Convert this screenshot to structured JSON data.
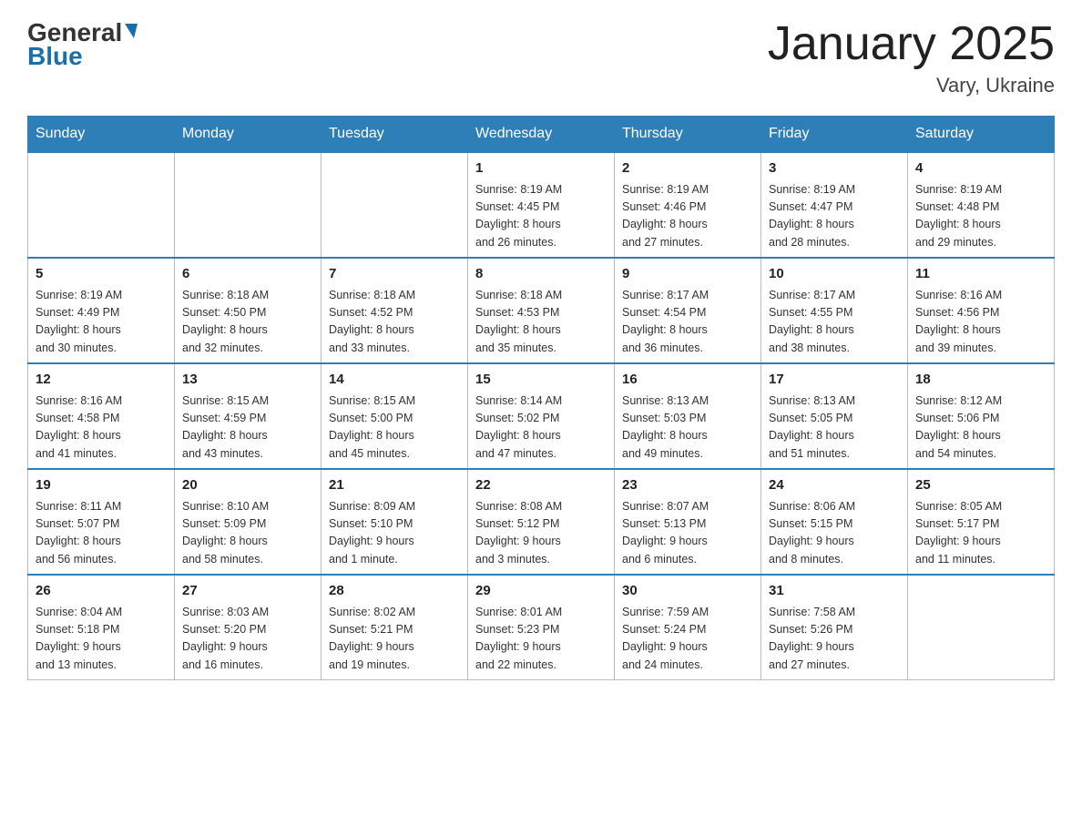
{
  "logo": {
    "general": "General",
    "blue": "Blue"
  },
  "title": "January 2025",
  "subtitle": "Vary, Ukraine",
  "days_of_week": [
    "Sunday",
    "Monday",
    "Tuesday",
    "Wednesday",
    "Thursday",
    "Friday",
    "Saturday"
  ],
  "weeks": [
    [
      {
        "day": "",
        "info": ""
      },
      {
        "day": "",
        "info": ""
      },
      {
        "day": "",
        "info": ""
      },
      {
        "day": "1",
        "info": "Sunrise: 8:19 AM\nSunset: 4:45 PM\nDaylight: 8 hours\nand 26 minutes."
      },
      {
        "day": "2",
        "info": "Sunrise: 8:19 AM\nSunset: 4:46 PM\nDaylight: 8 hours\nand 27 minutes."
      },
      {
        "day": "3",
        "info": "Sunrise: 8:19 AM\nSunset: 4:47 PM\nDaylight: 8 hours\nand 28 minutes."
      },
      {
        "day": "4",
        "info": "Sunrise: 8:19 AM\nSunset: 4:48 PM\nDaylight: 8 hours\nand 29 minutes."
      }
    ],
    [
      {
        "day": "5",
        "info": "Sunrise: 8:19 AM\nSunset: 4:49 PM\nDaylight: 8 hours\nand 30 minutes."
      },
      {
        "day": "6",
        "info": "Sunrise: 8:18 AM\nSunset: 4:50 PM\nDaylight: 8 hours\nand 32 minutes."
      },
      {
        "day": "7",
        "info": "Sunrise: 8:18 AM\nSunset: 4:52 PM\nDaylight: 8 hours\nand 33 minutes."
      },
      {
        "day": "8",
        "info": "Sunrise: 8:18 AM\nSunset: 4:53 PM\nDaylight: 8 hours\nand 35 minutes."
      },
      {
        "day": "9",
        "info": "Sunrise: 8:17 AM\nSunset: 4:54 PM\nDaylight: 8 hours\nand 36 minutes."
      },
      {
        "day": "10",
        "info": "Sunrise: 8:17 AM\nSunset: 4:55 PM\nDaylight: 8 hours\nand 38 minutes."
      },
      {
        "day": "11",
        "info": "Sunrise: 8:16 AM\nSunset: 4:56 PM\nDaylight: 8 hours\nand 39 minutes."
      }
    ],
    [
      {
        "day": "12",
        "info": "Sunrise: 8:16 AM\nSunset: 4:58 PM\nDaylight: 8 hours\nand 41 minutes."
      },
      {
        "day": "13",
        "info": "Sunrise: 8:15 AM\nSunset: 4:59 PM\nDaylight: 8 hours\nand 43 minutes."
      },
      {
        "day": "14",
        "info": "Sunrise: 8:15 AM\nSunset: 5:00 PM\nDaylight: 8 hours\nand 45 minutes."
      },
      {
        "day": "15",
        "info": "Sunrise: 8:14 AM\nSunset: 5:02 PM\nDaylight: 8 hours\nand 47 minutes."
      },
      {
        "day": "16",
        "info": "Sunrise: 8:13 AM\nSunset: 5:03 PM\nDaylight: 8 hours\nand 49 minutes."
      },
      {
        "day": "17",
        "info": "Sunrise: 8:13 AM\nSunset: 5:05 PM\nDaylight: 8 hours\nand 51 minutes."
      },
      {
        "day": "18",
        "info": "Sunrise: 8:12 AM\nSunset: 5:06 PM\nDaylight: 8 hours\nand 54 minutes."
      }
    ],
    [
      {
        "day": "19",
        "info": "Sunrise: 8:11 AM\nSunset: 5:07 PM\nDaylight: 8 hours\nand 56 minutes."
      },
      {
        "day": "20",
        "info": "Sunrise: 8:10 AM\nSunset: 5:09 PM\nDaylight: 8 hours\nand 58 minutes."
      },
      {
        "day": "21",
        "info": "Sunrise: 8:09 AM\nSunset: 5:10 PM\nDaylight: 9 hours\nand 1 minute."
      },
      {
        "day": "22",
        "info": "Sunrise: 8:08 AM\nSunset: 5:12 PM\nDaylight: 9 hours\nand 3 minutes."
      },
      {
        "day": "23",
        "info": "Sunrise: 8:07 AM\nSunset: 5:13 PM\nDaylight: 9 hours\nand 6 minutes."
      },
      {
        "day": "24",
        "info": "Sunrise: 8:06 AM\nSunset: 5:15 PM\nDaylight: 9 hours\nand 8 minutes."
      },
      {
        "day": "25",
        "info": "Sunrise: 8:05 AM\nSunset: 5:17 PM\nDaylight: 9 hours\nand 11 minutes."
      }
    ],
    [
      {
        "day": "26",
        "info": "Sunrise: 8:04 AM\nSunset: 5:18 PM\nDaylight: 9 hours\nand 13 minutes."
      },
      {
        "day": "27",
        "info": "Sunrise: 8:03 AM\nSunset: 5:20 PM\nDaylight: 9 hours\nand 16 minutes."
      },
      {
        "day": "28",
        "info": "Sunrise: 8:02 AM\nSunset: 5:21 PM\nDaylight: 9 hours\nand 19 minutes."
      },
      {
        "day": "29",
        "info": "Sunrise: 8:01 AM\nSunset: 5:23 PM\nDaylight: 9 hours\nand 22 minutes."
      },
      {
        "day": "30",
        "info": "Sunrise: 7:59 AM\nSunset: 5:24 PM\nDaylight: 9 hours\nand 24 minutes."
      },
      {
        "day": "31",
        "info": "Sunrise: 7:58 AM\nSunset: 5:26 PM\nDaylight: 9 hours\nand 27 minutes."
      },
      {
        "day": "",
        "info": ""
      }
    ]
  ]
}
